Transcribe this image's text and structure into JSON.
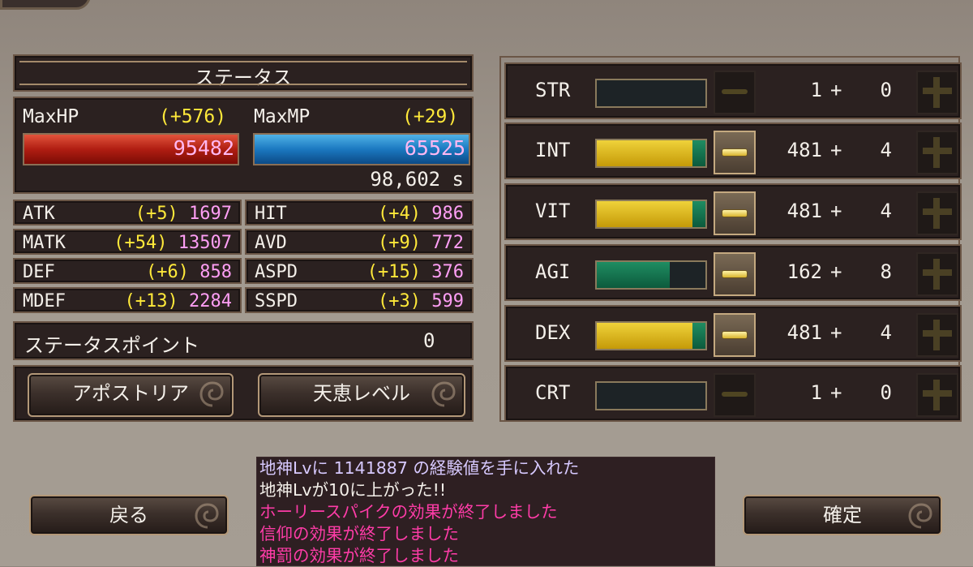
{
  "status_title": "ステータス",
  "hp": {
    "label": "MaxHP",
    "bonus": "(+576)",
    "value": "95482"
  },
  "mp": {
    "label": "MaxMP",
    "bonus": "(+29)",
    "value": "65525"
  },
  "gold": "98,602 s",
  "stats_left": [
    {
      "key": "ATK",
      "bonus": "(+5)",
      "value": "1697"
    },
    {
      "key": "MATK",
      "bonus": "(+54)",
      "value": "13507"
    },
    {
      "key": "DEF",
      "bonus": "(+6)",
      "value": "858"
    },
    {
      "key": "MDEF",
      "bonus": "(+13)",
      "value": "2284"
    }
  ],
  "stats_right": [
    {
      "key": "HIT",
      "bonus": "(+4)",
      "value": "986"
    },
    {
      "key": "AVD",
      "bonus": "(+9)",
      "value": "772"
    },
    {
      "key": "ASPD",
      "bonus": "(+15)",
      "value": "376"
    },
    {
      "key": "SSPD",
      "bonus": "(+3)",
      "value": "599"
    }
  ],
  "status_points": {
    "label": "ステータスポイント",
    "value": "0"
  },
  "buttons": {
    "apostoria": "アポストリア",
    "blessing_level": "天恵レベル",
    "back": "戻る",
    "confirm": "確定"
  },
  "attributes": [
    {
      "name": "STR",
      "base": "1",
      "plus": "+",
      "bonus": "0",
      "fill": 0.0,
      "fill_color": "none",
      "minus_enabled": false,
      "plus_enabled": false
    },
    {
      "name": "INT",
      "base": "481",
      "plus": "+",
      "bonus": "4",
      "fill": 1.0,
      "fill_color": "yellow",
      "minus_enabled": true,
      "plus_enabled": false
    },
    {
      "name": "VIT",
      "base": "481",
      "plus": "+",
      "bonus": "4",
      "fill": 1.0,
      "fill_color": "yellow",
      "minus_enabled": true,
      "plus_enabled": false
    },
    {
      "name": "AGI",
      "base": "162",
      "plus": "+",
      "bonus": "8",
      "fill": 0.67,
      "fill_color": "green",
      "minus_enabled": true,
      "plus_enabled": false
    },
    {
      "name": "DEX",
      "base": "481",
      "plus": "+",
      "bonus": "4",
      "fill": 1.0,
      "fill_color": "yellow",
      "minus_enabled": true,
      "plus_enabled": false
    },
    {
      "name": "CRT",
      "base": "1",
      "plus": "+",
      "bonus": "0",
      "fill": 0.0,
      "fill_color": "none",
      "minus_enabled": false,
      "plus_enabled": false
    }
  ],
  "log": [
    {
      "text": "地神Lvに 1141887 の経験値を手に入れた",
      "color": "lavender"
    },
    {
      "text": "地神Lvが10に上がった!!",
      "color": "white"
    },
    {
      "text": "ホーリースパイクの効果が終了しました",
      "color": "magenta"
    },
    {
      "text": "信仰の効果が終了しました",
      "color": "magenta"
    },
    {
      "text": "神罰の効果が終了しました",
      "color": "magenta"
    }
  ],
  "colors": {
    "bonus": "#ffe93a",
    "value": "#ffb8f2",
    "log_lavender": "#d7c9ff",
    "log_magenta": "#ff3ca8"
  }
}
